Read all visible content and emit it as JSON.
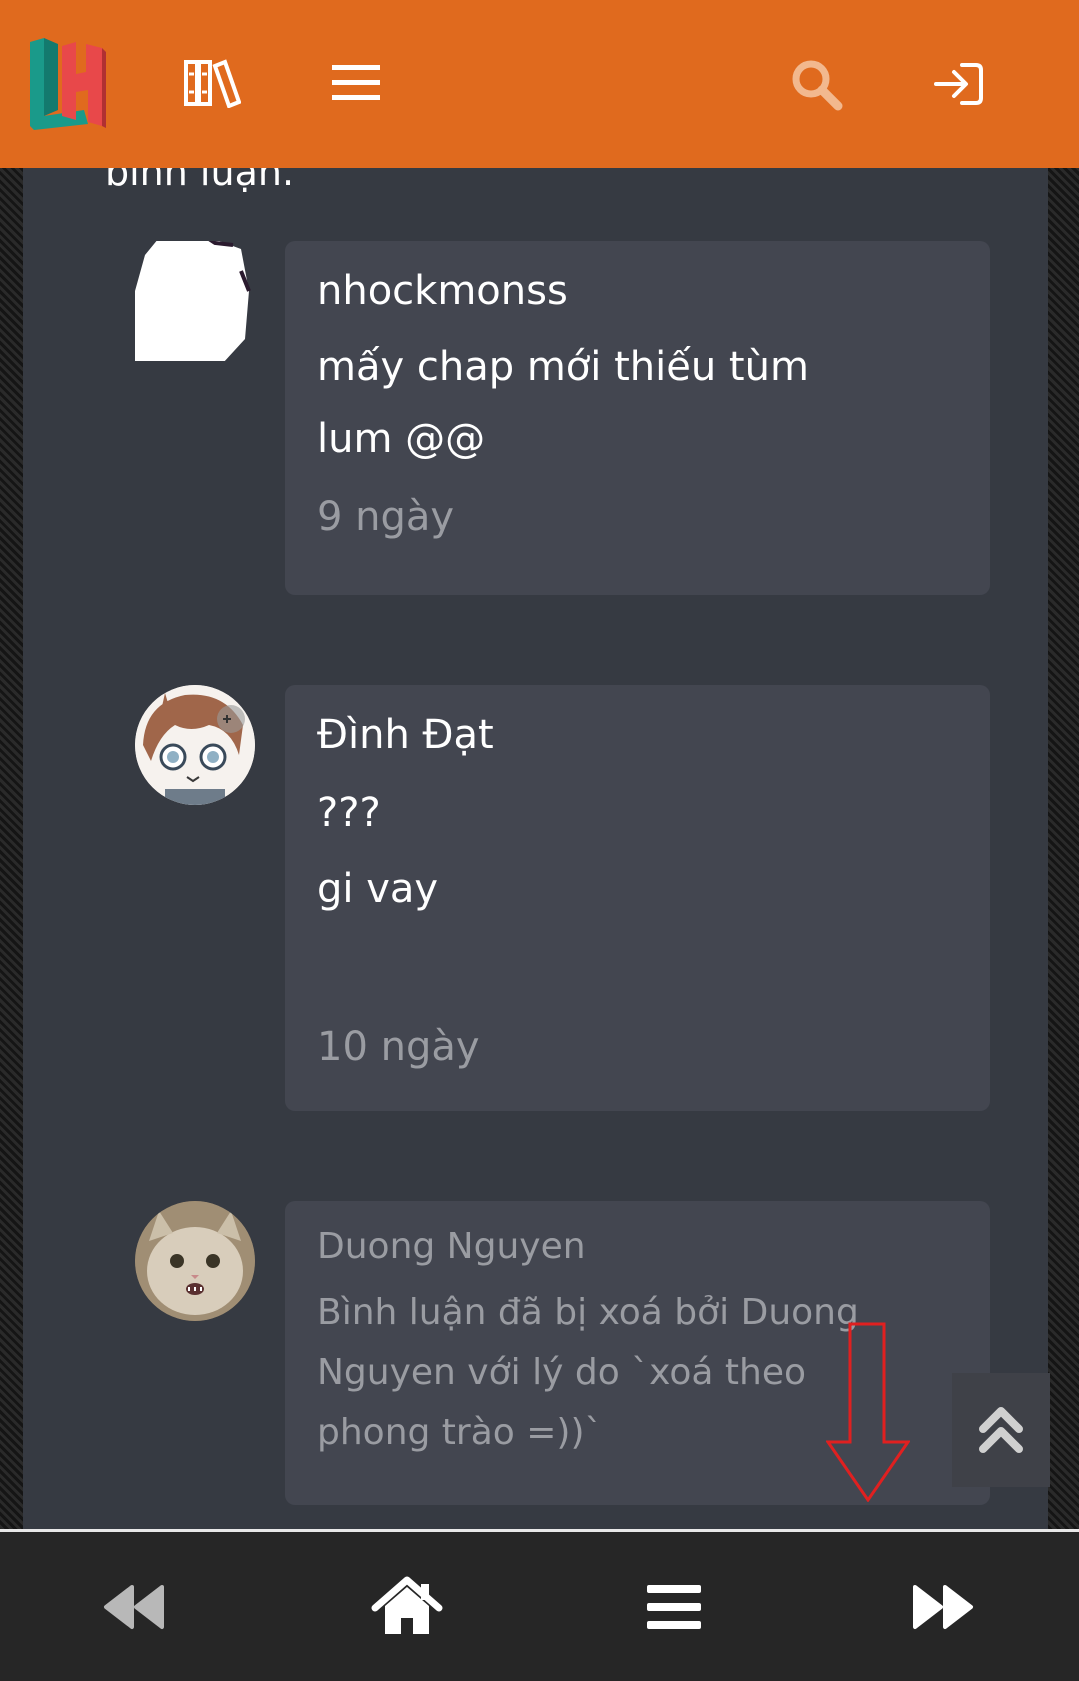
{
  "header": {
    "logo_icon": "lh-logo-icon",
    "library_icon": "library-icon",
    "menu_icon": "menu-icon",
    "search_icon": "search-icon",
    "login_icon": "login-icon",
    "background_color": "#e06a1e"
  },
  "partial_text": "bình luận.",
  "comments": [
    {
      "username": "nhockmonss",
      "body": "mấy chap mới thiếu tùm\nlum @@",
      "time": "9 ngày",
      "deleted": false
    },
    {
      "username": "Đình Đạt",
      "body": "???\ngi vay",
      "time": "10 ngày",
      "deleted": false
    },
    {
      "username": "Duong Nguyen",
      "body": "Bình luận đã bị xoá bởi Duong\nNguyen với lý do `xoá theo\nphong trào =))`",
      "time": "",
      "deleted": true
    }
  ],
  "scroll_top_icon": "double-chevron-up-icon",
  "bottom_nav": {
    "prev_icon": "backward-icon",
    "home_icon": "home-icon",
    "list_icon": "list-icon",
    "next_icon": "forward-icon"
  },
  "colors": {
    "content_bg": "#363a42",
    "card_bg": "#434650",
    "muted_text": "#9a9ca2",
    "annotation": "#e02020"
  }
}
